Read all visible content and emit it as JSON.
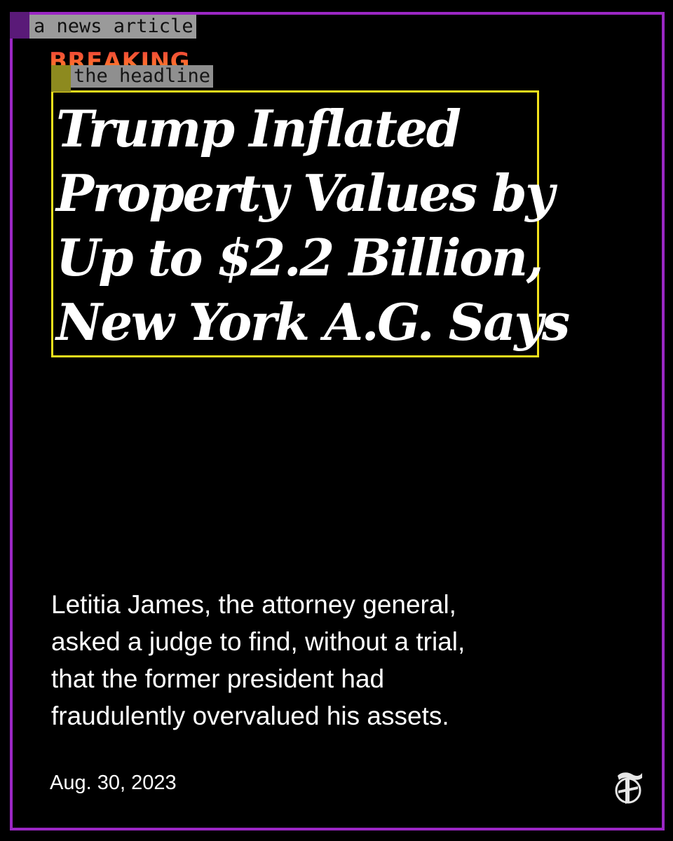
{
  "annotations": {
    "article_label": "a news article",
    "headline_label": "the headline",
    "article_color": "#9b27c4",
    "headline_color": "#f2e21c"
  },
  "article": {
    "kicker": "BREAKING",
    "headline_lines": [
      "Trump Inflated",
      "Property Values by",
      "Up to $2.2 Billion,",
      "New York A.G. Says"
    ],
    "summary_lines": [
      "Letitia James, the attorney general,",
      "asked a judge to find, without a trial,",
      "that the former president had",
      "fraudulently overvalued his assets."
    ],
    "date": "Aug. 30, 2023",
    "publisher_logo_icon": "nyt-t-logo-icon",
    "logo_letter": "T"
  }
}
